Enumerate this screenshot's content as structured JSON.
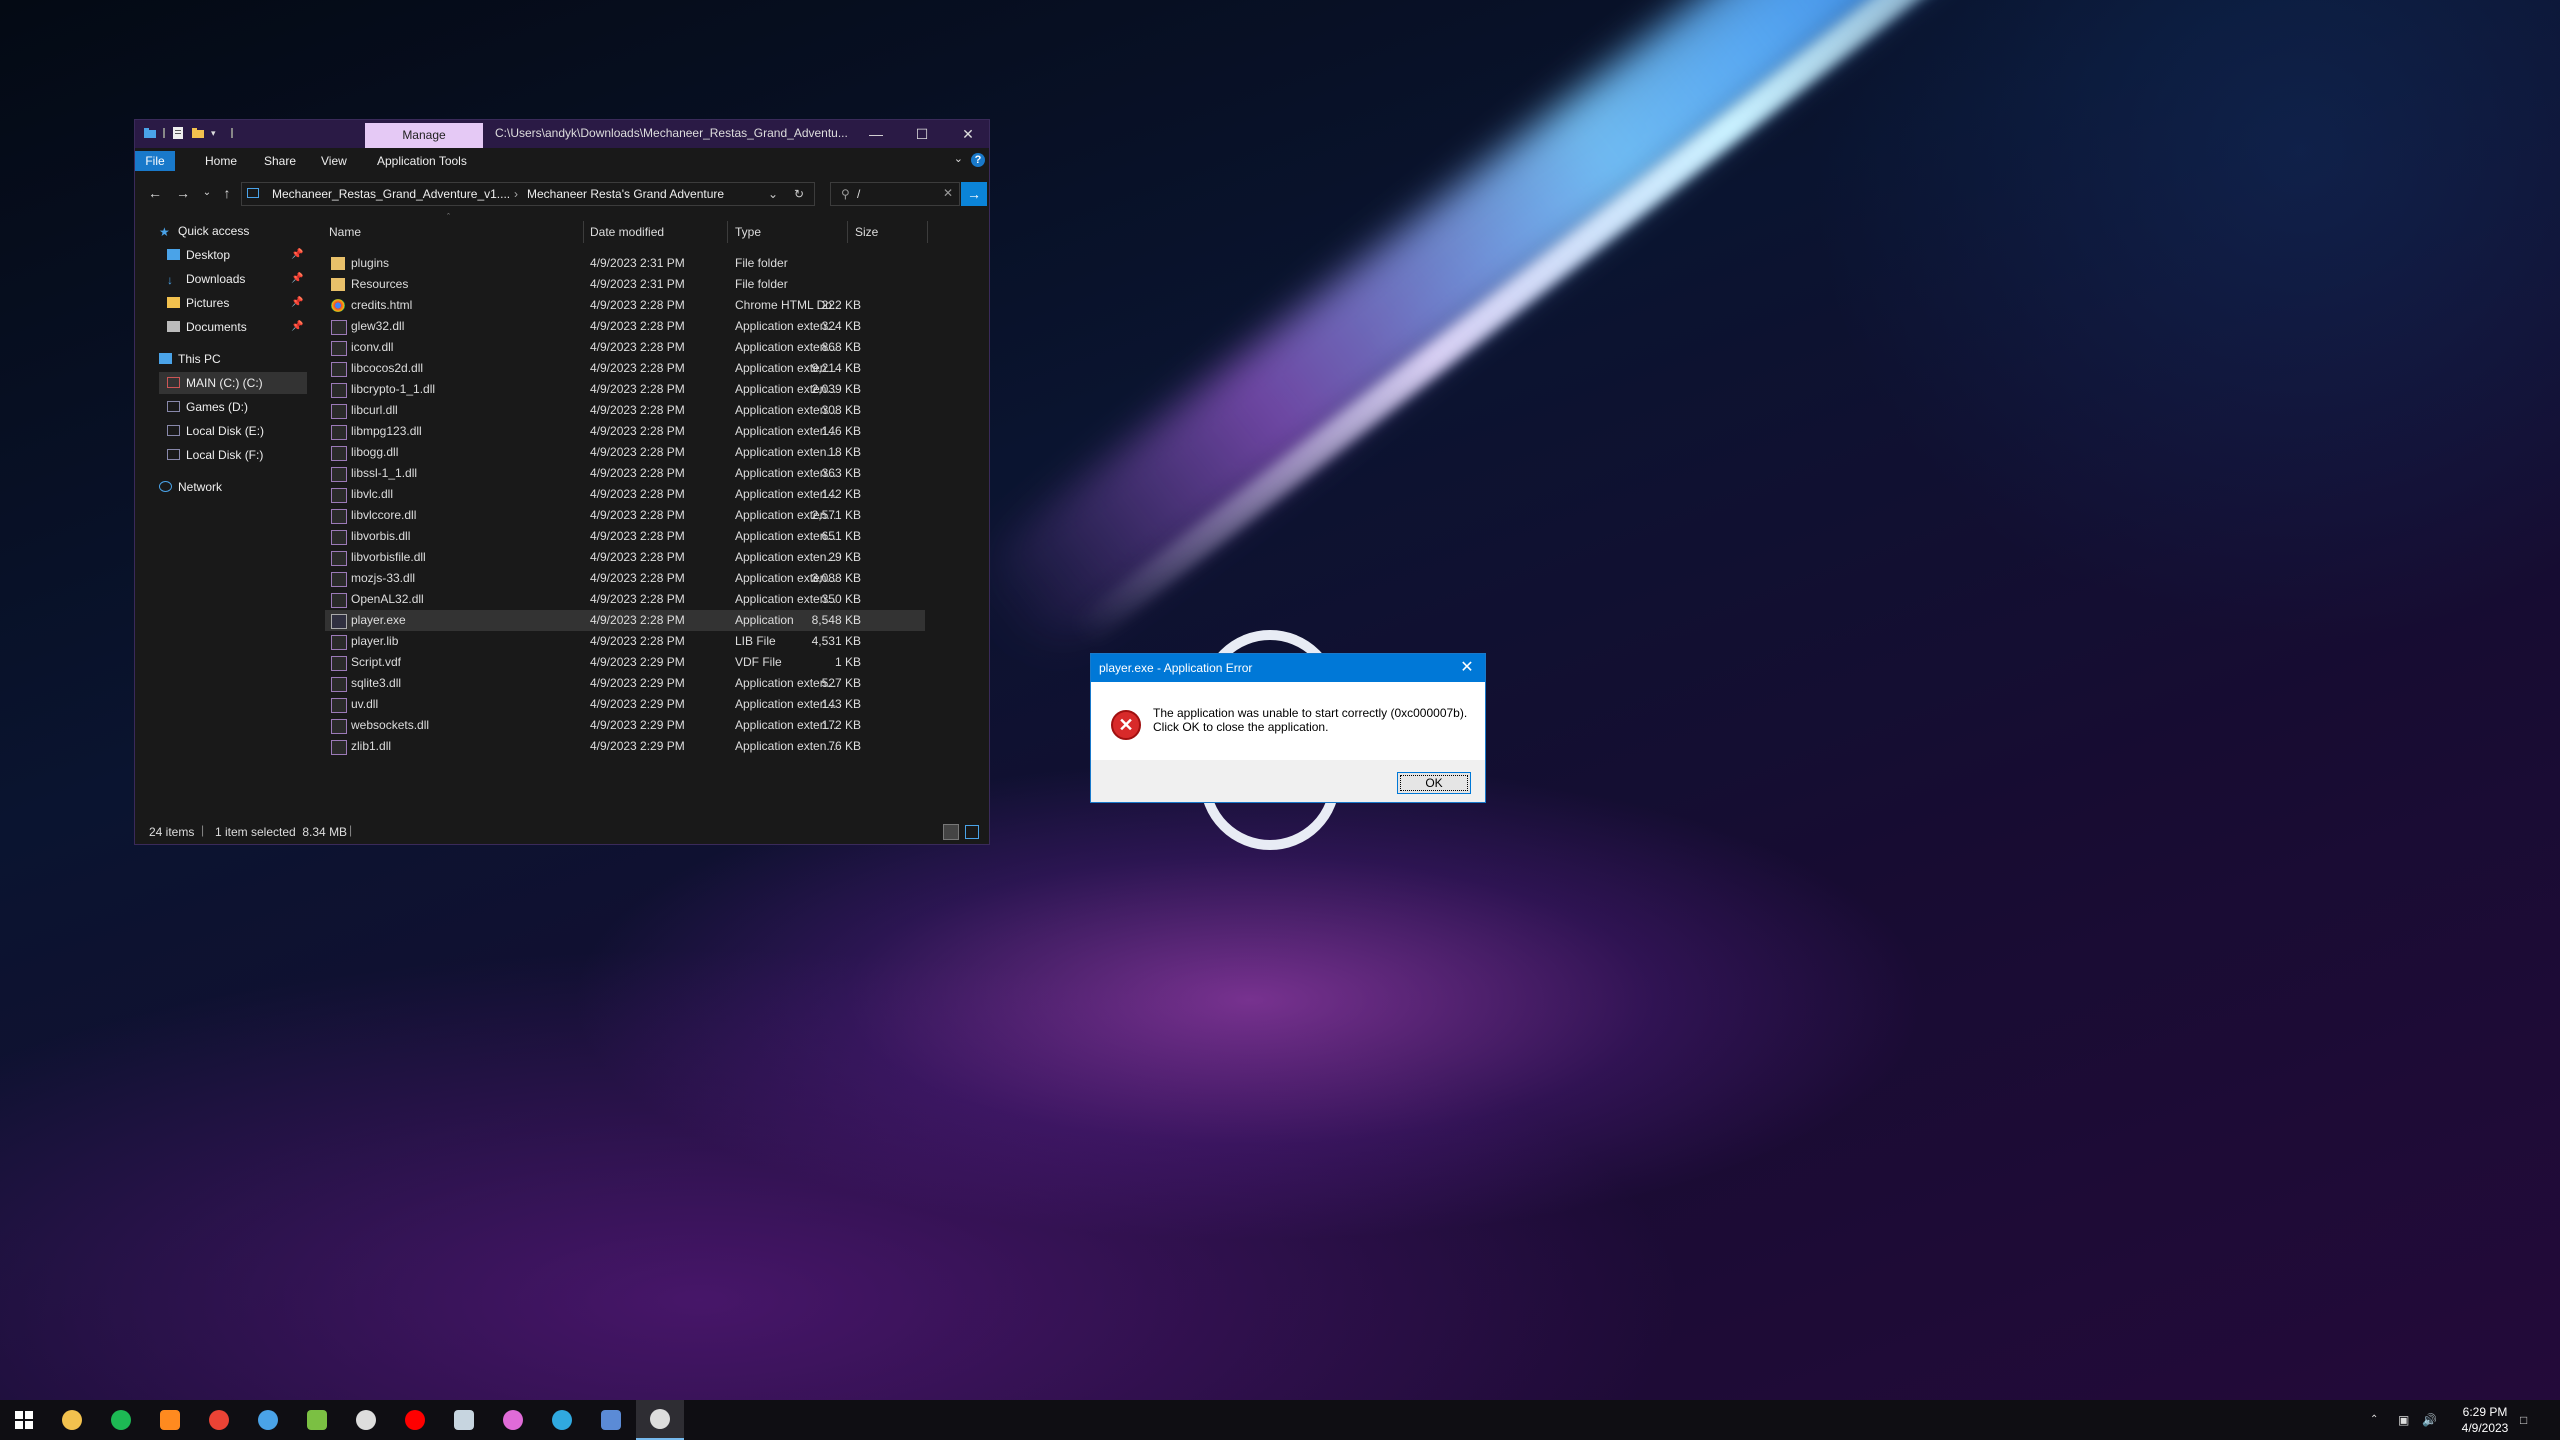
{
  "explorer": {
    "title_path": "C:\\Users\\andyk\\Downloads\\Mechaneer_Restas_Grand_Adventu...",
    "manage_tab": "Manage",
    "ribbon_tabs": [
      "File",
      "Home",
      "Share",
      "View",
      "Application Tools"
    ],
    "breadcrumb": [
      "Mechaneer_Restas_Grand_Adventure_v1....",
      "Mechaneer Resta's Grand Adventure"
    ],
    "search_value": "/",
    "nav": {
      "quick_access": "Quick access",
      "desktop": "Desktop",
      "downloads": "Downloads",
      "pictures": "Pictures",
      "documents": "Documents",
      "this_pc": "This PC",
      "main_c": "MAIN (C:) (C:)",
      "games_d": "Games (D:)",
      "local_e": "Local Disk (E:)",
      "local_f": "Local Disk (F:)",
      "network": "Network"
    },
    "columns": {
      "name": "Name",
      "date": "Date modified",
      "type": "Type",
      "size": "Size"
    },
    "files": [
      {
        "name": "plugins",
        "date": "4/9/2023 2:31 PM",
        "type": "File folder",
        "size": "",
        "icon": "folder-icon"
      },
      {
        "name": "Resources",
        "date": "4/9/2023 2:31 PM",
        "type": "File folder",
        "size": "",
        "icon": "folder-icon"
      },
      {
        "name": "credits.html",
        "date": "4/9/2023 2:28 PM",
        "type": "Chrome HTML Do...",
        "size": "222 KB",
        "icon": "chrome-icon"
      },
      {
        "name": "glew32.dll",
        "date": "4/9/2023 2:28 PM",
        "type": "Application exten...",
        "size": "324 KB",
        "icon": "dll-icon"
      },
      {
        "name": "iconv.dll",
        "date": "4/9/2023 2:28 PM",
        "type": "Application exten...",
        "size": "868 KB",
        "icon": "dll-icon"
      },
      {
        "name": "libcocos2d.dll",
        "date": "4/9/2023 2:28 PM",
        "type": "Application exten...",
        "size": "9,214 KB",
        "icon": "dll-icon"
      },
      {
        "name": "libcrypto-1_1.dll",
        "date": "4/9/2023 2:28 PM",
        "type": "Application exten...",
        "size": "2,039 KB",
        "icon": "dll-icon"
      },
      {
        "name": "libcurl.dll",
        "date": "4/9/2023 2:28 PM",
        "type": "Application exten...",
        "size": "308 KB",
        "icon": "dll-icon"
      },
      {
        "name": "libmpg123.dll",
        "date": "4/9/2023 2:28 PM",
        "type": "Application exten...",
        "size": "146 KB",
        "icon": "dll-icon"
      },
      {
        "name": "libogg.dll",
        "date": "4/9/2023 2:28 PM",
        "type": "Application exten...",
        "size": "18 KB",
        "icon": "dll-icon"
      },
      {
        "name": "libssl-1_1.dll",
        "date": "4/9/2023 2:28 PM",
        "type": "Application exten...",
        "size": "363 KB",
        "icon": "dll-icon"
      },
      {
        "name": "libvlc.dll",
        "date": "4/9/2023 2:28 PM",
        "type": "Application exten...",
        "size": "142 KB",
        "icon": "dll-icon"
      },
      {
        "name": "libvlccore.dll",
        "date": "4/9/2023 2:28 PM",
        "type": "Application exten...",
        "size": "2,571 KB",
        "icon": "dll-icon"
      },
      {
        "name": "libvorbis.dll",
        "date": "4/9/2023 2:28 PM",
        "type": "Application exten...",
        "size": "651 KB",
        "icon": "dll-icon"
      },
      {
        "name": "libvorbisfile.dll",
        "date": "4/9/2023 2:28 PM",
        "type": "Application exten...",
        "size": "29 KB",
        "icon": "dll-icon"
      },
      {
        "name": "mozjs-33.dll",
        "date": "4/9/2023 2:28 PM",
        "type": "Application exten...",
        "size": "3,088 KB",
        "icon": "dll-icon"
      },
      {
        "name": "OpenAL32.dll",
        "date": "4/9/2023 2:28 PM",
        "type": "Application exten...",
        "size": "350 KB",
        "icon": "dll-icon"
      },
      {
        "name": "player.exe",
        "date": "4/9/2023 2:28 PM",
        "type": "Application",
        "size": "8,548 KB",
        "icon": "exe-icon"
      },
      {
        "name": "player.lib",
        "date": "4/9/2023 2:28 PM",
        "type": "LIB File",
        "size": "4,531 KB",
        "icon": "file-icon"
      },
      {
        "name": "Script.vdf",
        "date": "4/9/2023 2:29 PM",
        "type": "VDF File",
        "size": "1 KB",
        "icon": "file-icon"
      },
      {
        "name": "sqlite3.dll",
        "date": "4/9/2023 2:29 PM",
        "type": "Application exten...",
        "size": "527 KB",
        "icon": "dll-icon"
      },
      {
        "name": "uv.dll",
        "date": "4/9/2023 2:29 PM",
        "type": "Application exten...",
        "size": "143 KB",
        "icon": "dll-icon"
      },
      {
        "name": "websockets.dll",
        "date": "4/9/2023 2:29 PM",
        "type": "Application exten...",
        "size": "172 KB",
        "icon": "dll-icon"
      },
      {
        "name": "zlib1.dll",
        "date": "4/9/2023 2:29 PM",
        "type": "Application exten...",
        "size": "76 KB",
        "icon": "dll-icon"
      }
    ],
    "selected_file": "player.exe",
    "status": {
      "items": "24 items",
      "selected": "1 item selected  8.34 MB"
    }
  },
  "dialog": {
    "title": "player.exe - Application Error",
    "line1": "The application was unable to start correctly (0xc000007b).",
    "line2": "Click OK to close the application.",
    "ok_label": "OK"
  },
  "taskbar": {
    "apps": [
      "windows-start-icon",
      "file-explorer-icon",
      "spotify-icon",
      "flame-app-icon",
      "chrome-icon",
      "browser-icon",
      "android-app-icon",
      "github-desktop-icon",
      "youtube-icon",
      "steam-icon",
      "pen-app-icon",
      "kodi-icon",
      "shield-app-icon",
      "terminal-app-icon"
    ],
    "clock_time": "6:29 PM",
    "clock_date": "4/9/2023"
  },
  "colors": {
    "accent": "#0078d7",
    "manage_tab": "#e5c9f5",
    "explorer_bg": "#191919",
    "taskbar_bg": "#0f0e13"
  }
}
